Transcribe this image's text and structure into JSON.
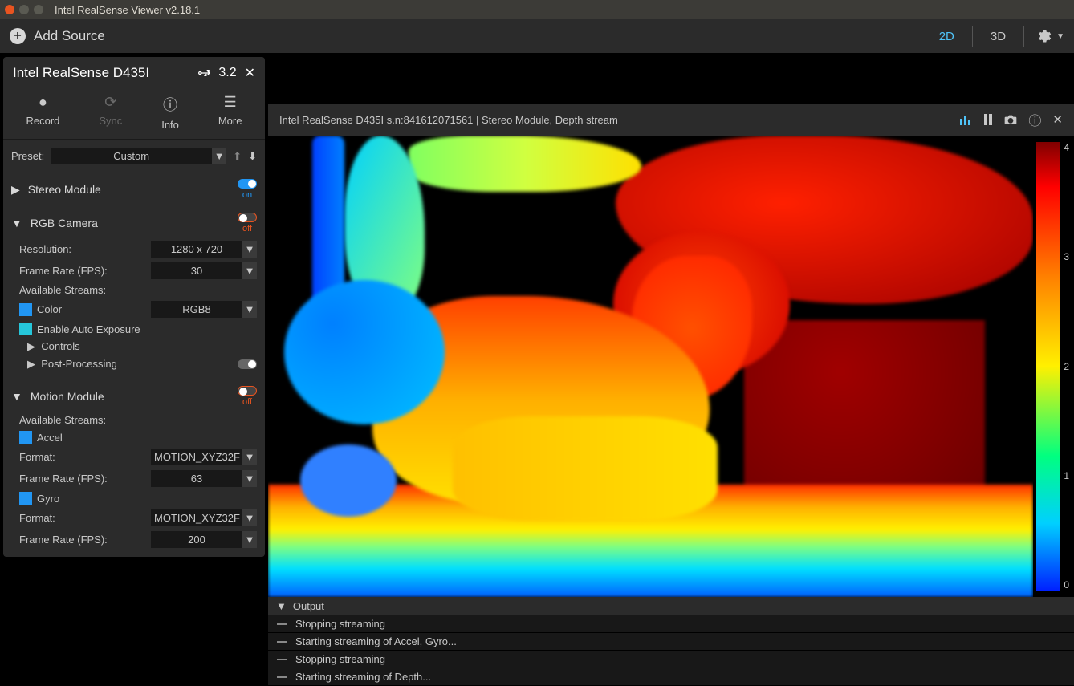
{
  "window": {
    "title": "Intel RealSense Viewer v2.18.1"
  },
  "toolbar": {
    "add_source": "Add Source",
    "view_2d": "2D",
    "view_3d": "3D"
  },
  "device": {
    "name": "Intel RealSense D435I",
    "usb_version": "3.2",
    "tools": {
      "record": "Record",
      "sync": "Sync",
      "info": "Info",
      "more": "More"
    },
    "preset_label": "Preset:",
    "preset_value": "Custom"
  },
  "modules": {
    "stereo": {
      "title": "Stereo Module",
      "state": "on"
    },
    "rgb": {
      "title": "RGB Camera",
      "state": "off",
      "resolution_label": "Resolution:",
      "resolution_value": "1280 x 720",
      "fps_label": "Frame Rate (FPS):",
      "fps_value": "30",
      "available_label": "Available Streams:",
      "color_label": "Color",
      "color_format": "RGB8",
      "auto_exposure_label": "Enable Auto Exposure",
      "controls": "Controls",
      "postproc": "Post-Processing"
    },
    "motion": {
      "title": "Motion Module",
      "state": "off",
      "available_label": "Available Streams:",
      "accel_label": "Accel",
      "gyro_label": "Gyro",
      "format_label": "Format:",
      "accel_format": "MOTION_XYZ32F",
      "accel_fps_label": "Frame Rate (FPS):",
      "accel_fps": "63",
      "gyro_format": "MOTION_XYZ32F",
      "gyro_fps_label": "Frame Rate (FPS):",
      "gyro_fps": "200"
    }
  },
  "stream": {
    "title": "Intel RealSense D435I s.n:841612071561 | Stereo Module, Depth stream",
    "scale": {
      "ticks": [
        "4",
        "3",
        "2",
        "1",
        "0"
      ]
    }
  },
  "output": {
    "title": "Output",
    "logs": [
      "Stopping streaming",
      "Starting streaming of Accel, Gyro...",
      "Stopping streaming",
      "Starting streaming of Depth..."
    ]
  }
}
